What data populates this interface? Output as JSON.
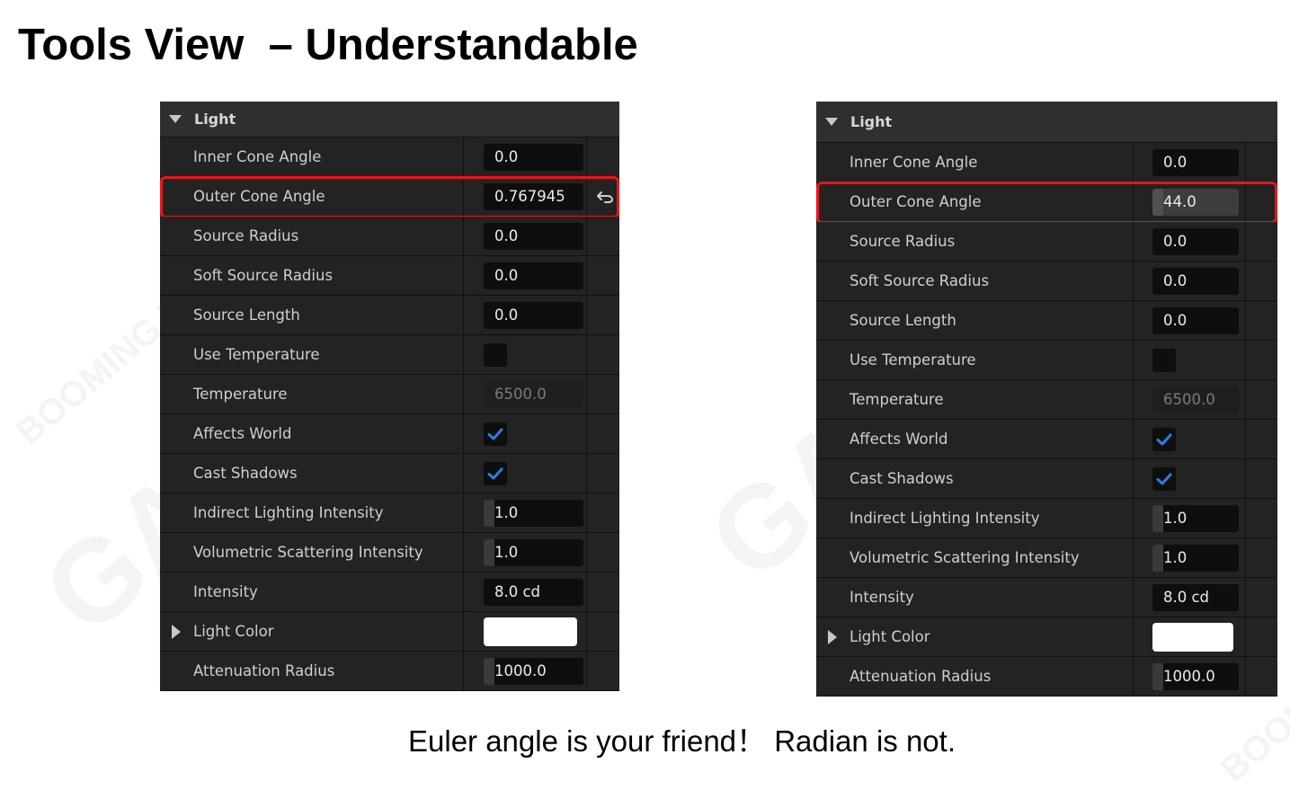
{
  "slide": {
    "title": "Tools View  – Understandable",
    "caption": "Euler angle is your friend！ Radian is not."
  },
  "colors": {
    "highlight": "#e8151d",
    "checkmark": "#2a7fe0",
    "panel_bg": "#1b1b1b"
  },
  "watermark": {
    "text_a": "GAMES104",
    "text_b": "BOOMING TECH"
  },
  "left_panel": {
    "section": "Light",
    "rows": [
      {
        "label": "Inner Cone Angle",
        "kind": "field",
        "value": "0.0"
      },
      {
        "label": "Outer Cone Angle",
        "kind": "field",
        "value": "0.767945",
        "highlighted": true,
        "reset_icon": "reset-arrow-icon"
      },
      {
        "label": "Source Radius",
        "kind": "field",
        "value": "0.0"
      },
      {
        "label": "Soft Source Radius",
        "kind": "field",
        "value": "0.0"
      },
      {
        "label": "Source Length",
        "kind": "field",
        "value": "0.0"
      },
      {
        "label": "Use Temperature",
        "kind": "checkbox",
        "checked": false
      },
      {
        "label": "Temperature",
        "kind": "field",
        "value": "6500.0",
        "disabled": true
      },
      {
        "label": "Affects World",
        "kind": "checkbox",
        "checked": true
      },
      {
        "label": "Cast Shadows",
        "kind": "checkbox",
        "checked": true
      },
      {
        "label": "Indirect Lighting Intensity",
        "kind": "spinner",
        "value": "1.0"
      },
      {
        "label": "Volumetric Scattering Intensity",
        "kind": "spinner",
        "value": "1.0"
      },
      {
        "label": "Intensity",
        "kind": "field",
        "value": "8.0 cd"
      },
      {
        "label": "Light Color",
        "kind": "color",
        "value": "#ffffff",
        "expandable": true
      },
      {
        "label": "Attenuation Radius",
        "kind": "spinner",
        "value": "1000.0"
      }
    ]
  },
  "right_panel": {
    "section": "Light",
    "rows": [
      {
        "label": "Inner Cone Angle",
        "kind": "field",
        "value": "0.0"
      },
      {
        "label": "Outer Cone Angle",
        "kind": "field",
        "value": "44.0",
        "highlighted": true,
        "selected": true
      },
      {
        "label": "Source Radius",
        "kind": "field",
        "value": "0.0"
      },
      {
        "label": "Soft Source Radius",
        "kind": "field",
        "value": "0.0"
      },
      {
        "label": "Source Length",
        "kind": "field",
        "value": "0.0"
      },
      {
        "label": "Use Temperature",
        "kind": "checkbox",
        "checked": false
      },
      {
        "label": "Temperature",
        "kind": "field",
        "value": "6500.0",
        "disabled": true
      },
      {
        "label": "Affects World",
        "kind": "checkbox",
        "checked": true
      },
      {
        "label": "Cast Shadows",
        "kind": "checkbox",
        "checked": true
      },
      {
        "label": "Indirect Lighting Intensity",
        "kind": "spinner",
        "value": "1.0"
      },
      {
        "label": "Volumetric Scattering Intensity",
        "kind": "spinner",
        "value": "1.0"
      },
      {
        "label": "Intensity",
        "kind": "field",
        "value": "8.0 cd"
      },
      {
        "label": "Light Color",
        "kind": "color",
        "value": "#ffffff",
        "expandable": true
      },
      {
        "label": "Attenuation Radius",
        "kind": "spinner",
        "value": "1000.0"
      }
    ]
  }
}
